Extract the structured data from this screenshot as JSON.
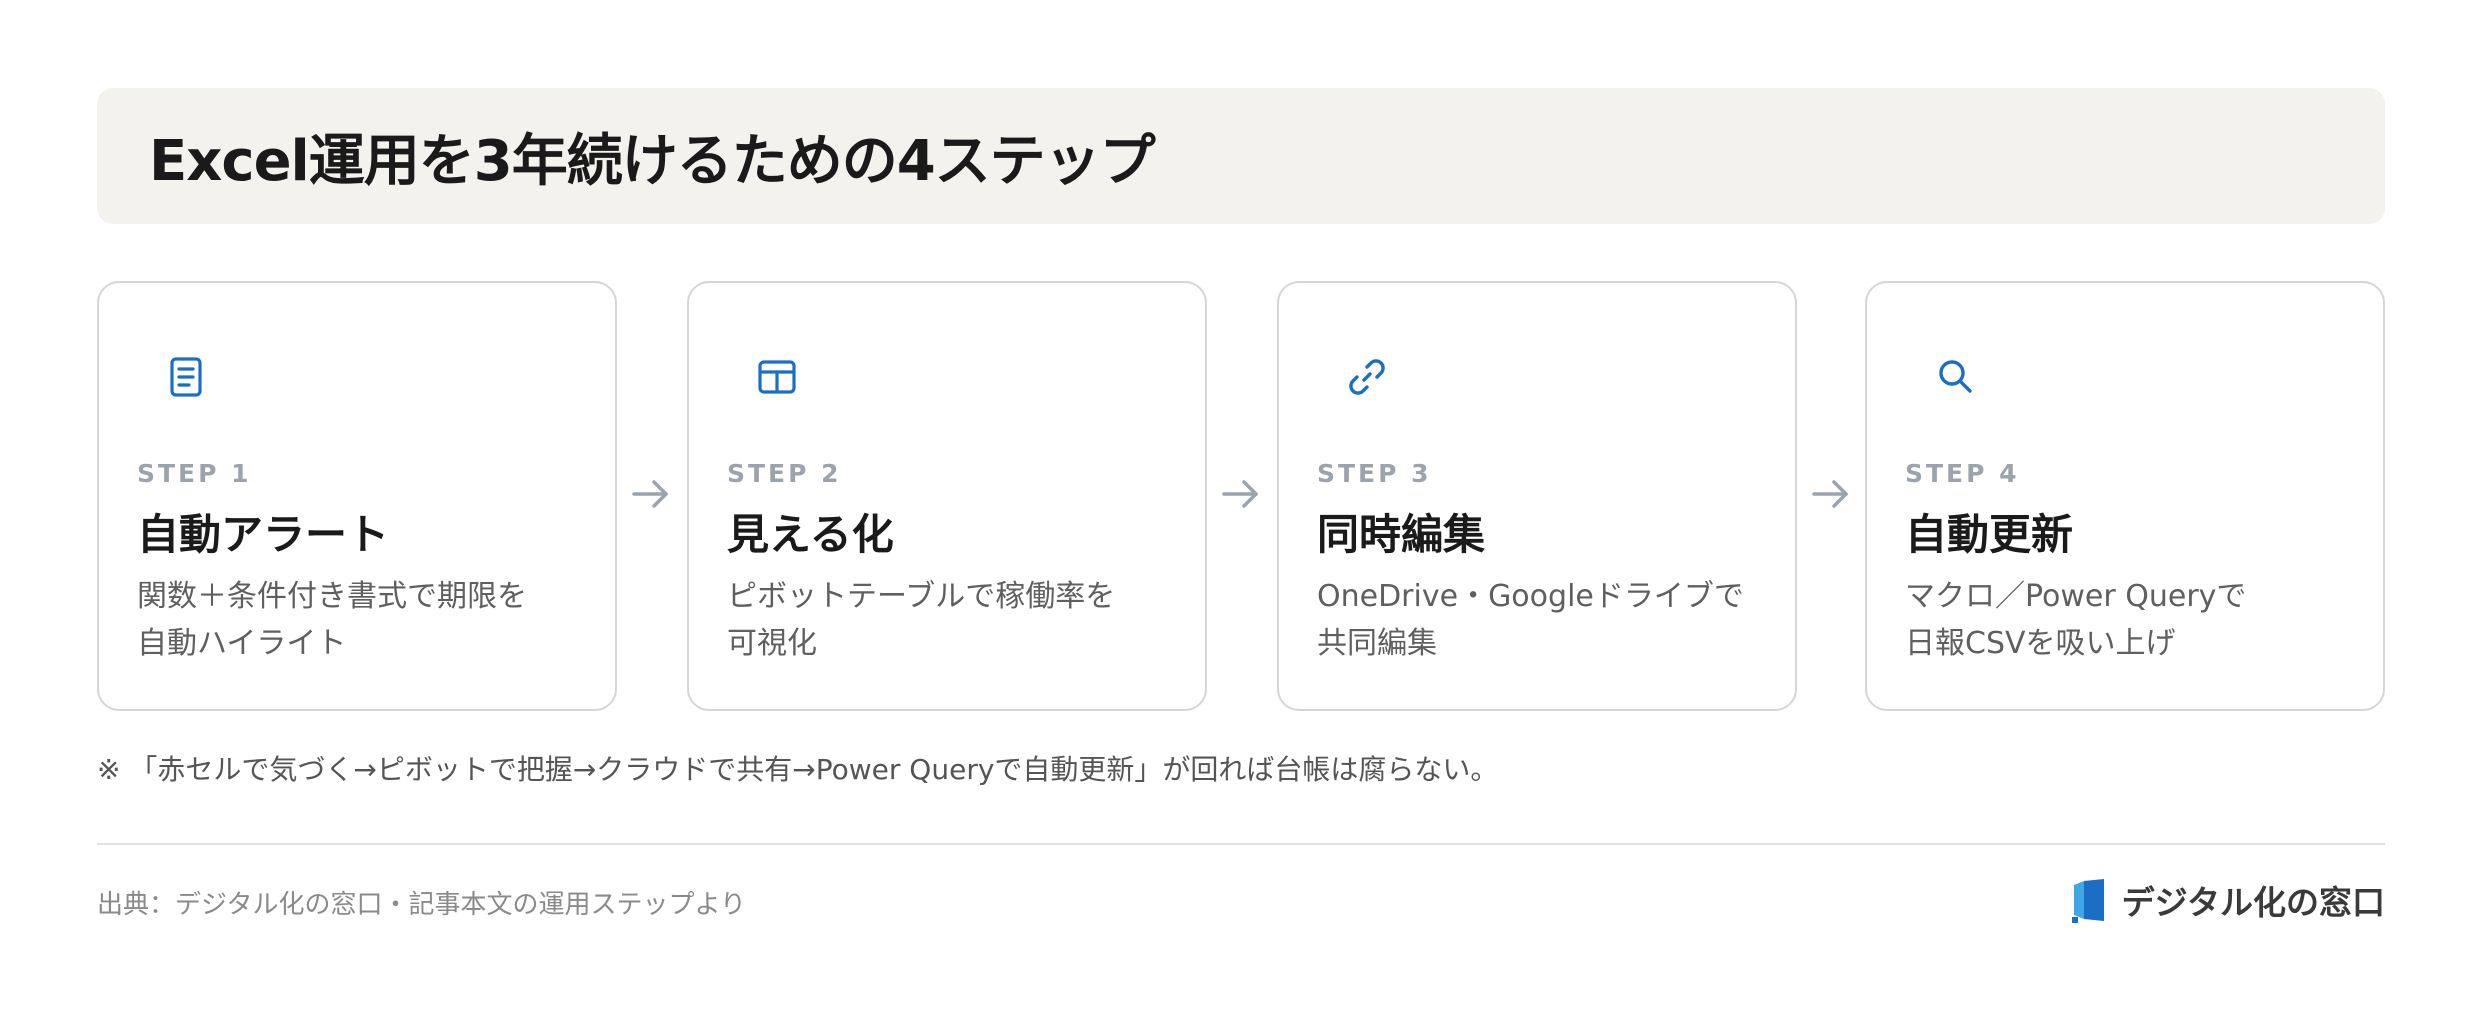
{
  "header": {
    "title": "Excel運用を3年続けるための4ステップ"
  },
  "steps": [
    {
      "label": "STEP 1",
      "title": "自動アラート",
      "desc_line1": "関数＋条件付き書式で期限を",
      "desc_line2": "自動ハイライト",
      "icon": "document-icon"
    },
    {
      "label": "STEP 2",
      "title": "見える化",
      "desc_line1": "ピボットテーブルで稼働率を",
      "desc_line2": "可視化",
      "icon": "table-icon"
    },
    {
      "label": "STEP 3",
      "title": "同時編集",
      "desc_line1": "OneDrive・Googleドライブで",
      "desc_line2": "共同編集",
      "icon": "link-icon"
    },
    {
      "label": "STEP 4",
      "title": "自動更新",
      "desc_line1": "マクロ／Power Queryで",
      "desc_line2": "日報CSVを吸い上げ",
      "icon": "search-icon"
    }
  ],
  "note": "※ 「赤セルで気づく→ピボットで把握→クラウドで共有→Power Queryで自動更新」が回れば台帳は腐らない。",
  "footer": {
    "source": "出典：デジタル化の窓口・記事本文の運用ステップより",
    "brand": "デジタル化の窓口"
  },
  "colors": {
    "accent": "#1a6fc4",
    "header_bg": "#f4f2ec",
    "muted": "#9aa3ae"
  }
}
